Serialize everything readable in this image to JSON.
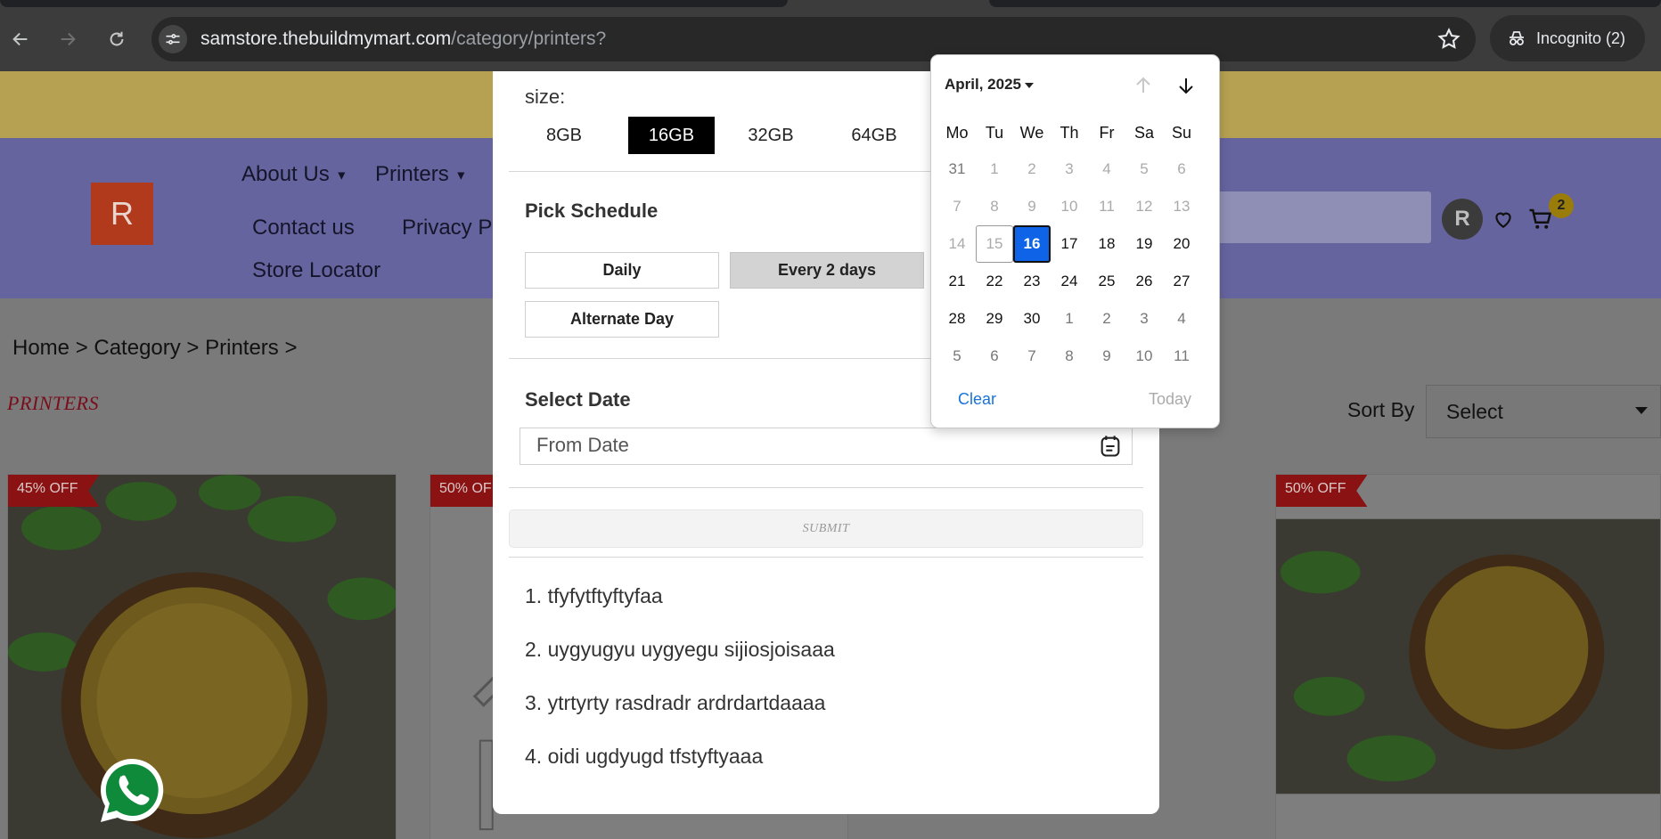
{
  "browser": {
    "url_domain": "samstore.thebuildmymart.com",
    "url_path": "/category/printers?",
    "incognito_label": "Incognito (2)"
  },
  "site": {
    "logo_letter": "R",
    "nav": {
      "about": "About Us",
      "printers": "Printers",
      "contact": "Contact us",
      "privacy": "Privacy P",
      "store_locator": "Store Locator"
    },
    "avatar_letter": "R",
    "cart_count": "2",
    "breadcrumb": "Home > Category > Printers >",
    "category_title": "PRINTERS",
    "sort_label": "Sort By",
    "sort_value": "Select",
    "products": [
      {
        "badge": "45% OFF"
      },
      {
        "badge": "50% OF"
      },
      {
        "badge": "50% OFF"
      }
    ]
  },
  "modal": {
    "size_label": "size:",
    "sizes": [
      "8GB",
      "16GB",
      "32GB",
      "64GB"
    ],
    "selected_size": "16GB",
    "schedule_title": "Pick Schedule",
    "schedule_options": [
      "Daily",
      "Every 2 days",
      "Alternate Day"
    ],
    "selected_schedule": "Every 2 days",
    "date_title": "Select Date",
    "date_placeholder": "From Date",
    "submit_label": "SUBMIT",
    "notes": [
      "1. tfyfytftyftyfaa",
      "2. uygyugyu uygyegu sijiosjoisaaa",
      "3. ytrtyrty rasdradr ardrdartdaaaa",
      "4. oidi ugdyugd tfstyftyaaa"
    ]
  },
  "datepicker": {
    "month_label": "April, 2025",
    "weekdays": [
      "Mo",
      "Tu",
      "We",
      "Th",
      "Fr",
      "Sa",
      "Su"
    ],
    "weeks": [
      [
        "31",
        "1",
        "2",
        "3",
        "4",
        "5",
        "6"
      ],
      [
        "7",
        "8",
        "9",
        "10",
        "11",
        "12",
        "13"
      ],
      [
        "14",
        "15",
        "16",
        "17",
        "18",
        "19",
        "20"
      ],
      [
        "21",
        "22",
        "23",
        "24",
        "25",
        "26",
        "27"
      ],
      [
        "28",
        "29",
        "30",
        "1",
        "2",
        "3",
        "4"
      ],
      [
        "5",
        "6",
        "7",
        "8",
        "9",
        "10",
        "11"
      ]
    ],
    "selected_day": "16",
    "today_day": "15",
    "clear_label": "Clear",
    "today_label": "Today",
    "accent_color": "#0e63e6"
  }
}
